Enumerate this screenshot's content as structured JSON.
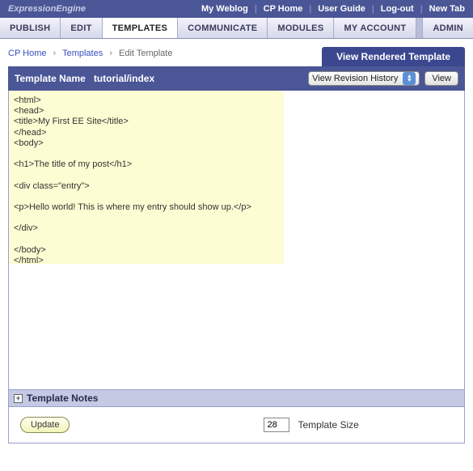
{
  "topbar": {
    "brand": "ExpressionEngine",
    "links": [
      "My Weblog",
      "CP Home",
      "User Guide",
      "Log-out",
      "New Tab"
    ]
  },
  "tabs": [
    {
      "label": "PUBLISH"
    },
    {
      "label": "EDIT"
    },
    {
      "label": "TEMPLATES",
      "active": true
    },
    {
      "label": "COMMUNICATE"
    },
    {
      "label": "MODULES"
    },
    {
      "label": "MY ACCOUNT"
    },
    {
      "label": "ADMIN"
    }
  ],
  "breadcrumbs": {
    "items": [
      "CP Home",
      "Templates",
      "Edit Template"
    ]
  },
  "view_rendered": "View Rendered Template",
  "titlebar": {
    "label": "Template Name",
    "value": "tutorial/index",
    "revision_label": "View Revision History",
    "view_label": "View"
  },
  "editor": {
    "content": "<html>\n<head>\n<title>My First EE Site</title>\n</head>\n<body>\n\n<h1>The title of my post</h1>\n\n<div class=\"entry\">\n\n<p>Hello world! This is where my entry should show up.</p>\n\n</div>\n\n</body>\n</html>"
  },
  "notes": {
    "label": "Template Notes"
  },
  "footer": {
    "update_label": "Update",
    "size_value": "28",
    "size_label": "Template Size"
  }
}
